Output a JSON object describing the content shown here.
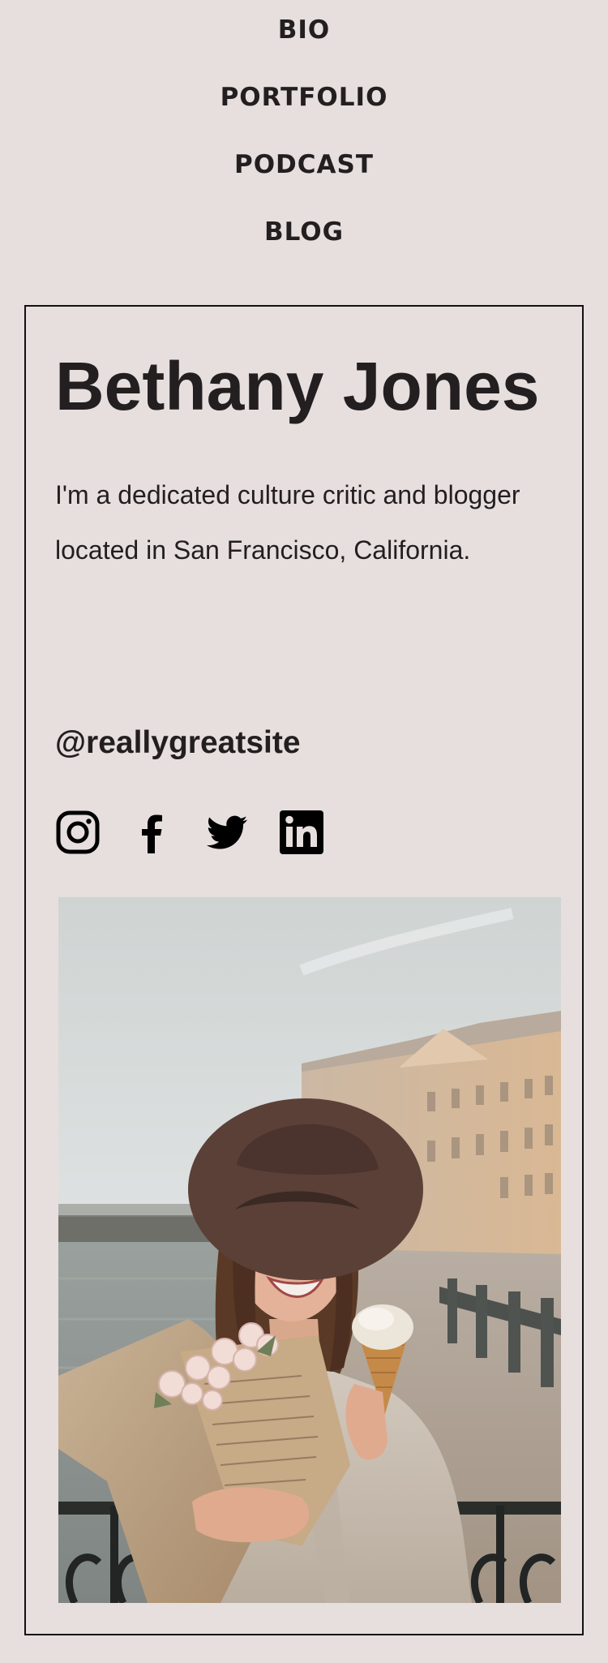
{
  "nav": {
    "items": [
      {
        "label": "BIO"
      },
      {
        "label": "PORTFOLIO"
      },
      {
        "label": "PODCAST"
      },
      {
        "label": "BLOG"
      }
    ]
  },
  "profile": {
    "name": "Bethany Jones",
    "bio": "I'm a dedicated culture critic and blogger located in San Francisco, California.",
    "handle": "@reallygreatsite"
  },
  "social": {
    "icons": [
      "instagram-icon",
      "facebook-icon",
      "twitter-icon",
      "linkedin-icon"
    ]
  },
  "colors": {
    "background": "#e6dfde",
    "text": "#231f20",
    "border": "#111111"
  }
}
